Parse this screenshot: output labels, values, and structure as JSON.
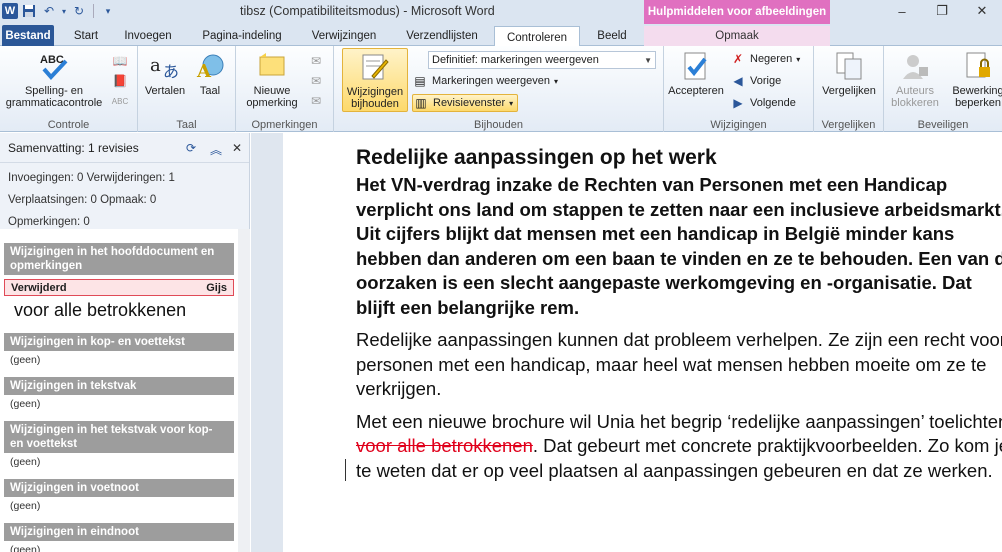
{
  "window": {
    "title": "tibsz (Compatibiliteitsmodus)  -  Microsoft Word",
    "context_tab_title": "Hulpmiddelen voor afbeeldingen",
    "app_icon": "W"
  },
  "tabs": [
    "Bestand",
    "Start",
    "Invoegen",
    "Pagina-indeling",
    "Verwijzingen",
    "Verzendlijsten",
    "Controleren",
    "Beeld",
    "Opmaak"
  ],
  "ribbon": {
    "proofing": {
      "spelling": "Spelling- en grammaticacontrole",
      "group": "Controle"
    },
    "language": {
      "translate": "Vertalen",
      "language": "Taal",
      "group": "Taal"
    },
    "comments": {
      "new": "Nieuwe opmerking",
      "group": "Opmerkingen"
    },
    "tracking": {
      "track": "Wijzigingen bijhouden",
      "display_combo": "Definitief: markeringen weergeven",
      "show_markup": "Markeringen weergeven",
      "reviewing_pane": "Revisievenster",
      "group": "Bijhouden"
    },
    "changes": {
      "accept": "Accepteren",
      "reject": "Negeren",
      "previous": "Vorige",
      "next": "Volgende",
      "group": "Wijzigingen"
    },
    "compare": {
      "compare": "Vergelijken",
      "group": "Vergelijken"
    },
    "protect": {
      "block_authors": "Auteurs blokkeren",
      "restrict": "Bewerking beperken",
      "group": "Beveiligen"
    }
  },
  "pane": {
    "title": "Samenvatting: 1 revisies",
    "summary": [
      "Invoegingen: 0  Verwijderingen: 1",
      "Verplaatsingen: 0  Opmaak: 0",
      "Opmerkingen: 0"
    ],
    "main_section": "Wijzigingen in het hoofddocument en opmerkingen",
    "revision": {
      "type": "Verwijderd",
      "author": "Gijs",
      "text": "voor alle betrokkenen"
    },
    "sections": [
      {
        "title": "Wijzigingen in kop- en voettekst",
        "value": "(geen)"
      },
      {
        "title": "Wijzigingen in tekstvak",
        "value": "(geen)"
      },
      {
        "title": "Wijzigingen in het tekstvak voor kop- en voettekst",
        "value": "(geen)"
      },
      {
        "title": "Wijzigingen in voetnoot",
        "value": "(geen)"
      },
      {
        "title": "Wijzigingen in eindnoot",
        "value": "(geen)"
      }
    ]
  },
  "document": {
    "heading": "Redelijke aanpassingen op het werk",
    "intro": "Het VN-verdrag inzake de Rechten van Personen met een Handicap verplicht ons land om stappen te zetten naar een inclusieve arbeidsmarkt. Uit cijfers blijkt dat mensen met een handicap in België minder kans hebben dan anderen om een baan te vinden en ze te behouden. Een van de oorzaken is een slecht aangepaste werkomgeving en -organisatie. Dat blijft een belangrijke rem.",
    "p2": "Redelijke aanpassingen kunnen dat probleem verhelpen. Ze zijn een recht voor personen met een handicap, maar heel wat mensen hebben moeite om ze te verkrijgen.",
    "p3_before": "Met een nieuwe brochure wil Unia het begrip ‘redelijke aanpassingen’ toelichten",
    "p3_deleted": " voor alle betrokkenen",
    "p3_after": ". Dat gebeurt met concrete praktijkvoorbeelden. Zo kom je te weten dat er op veel plaatsen al aanpassingen gebeuren en dat ze werken."
  }
}
